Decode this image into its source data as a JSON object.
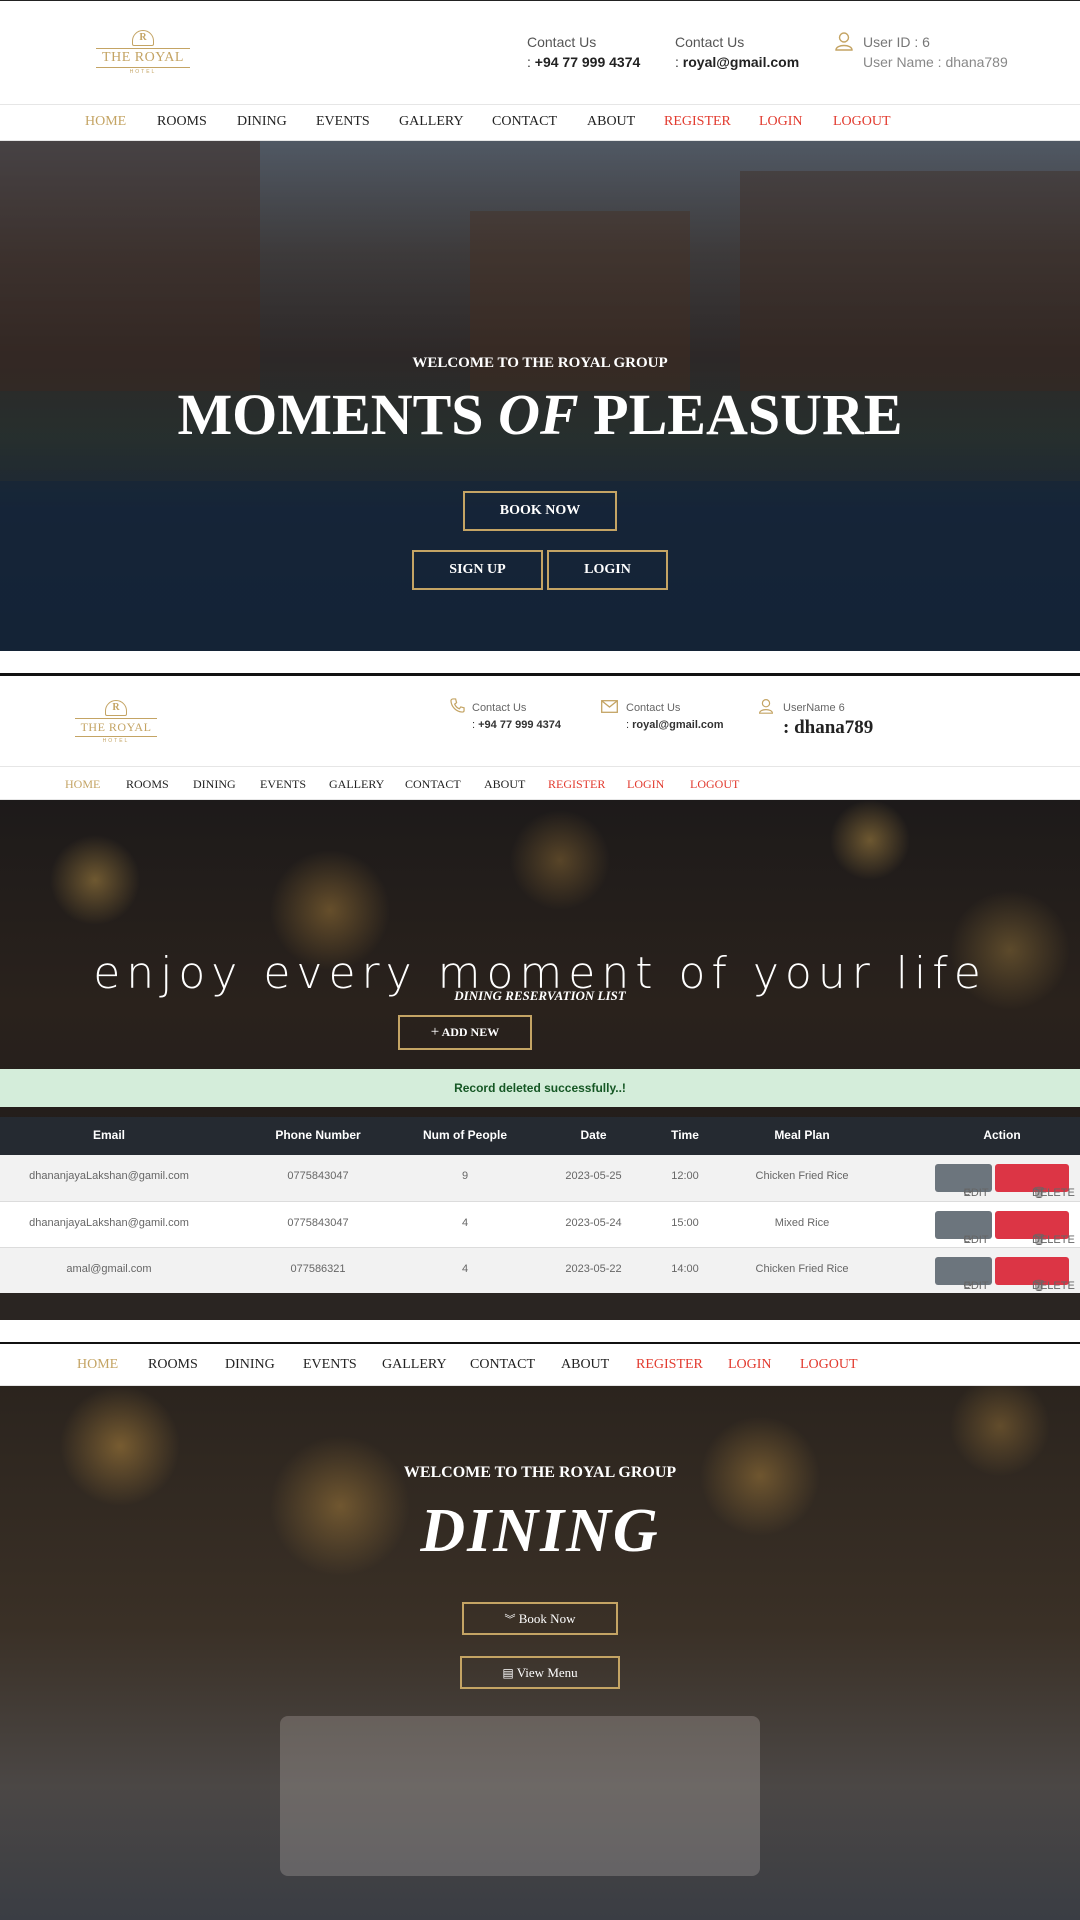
{
  "section1": {
    "logo": {
      "crest": "R",
      "name": "THE ROYAL",
      "sub": "HOTEL"
    },
    "contact_phone": {
      "label": "Contact Us",
      "prefix": ": ",
      "value": "+94 77 999 4374"
    },
    "contact_email": {
      "label": "Contact Us",
      "prefix": ": ",
      "value": "royal@gmail.com"
    },
    "user": {
      "id_line": "User ID : 6",
      "name_line": "User Name : dhana789"
    },
    "nav": [
      "HOME",
      "ROOMS",
      "DINING",
      "EVENTS",
      "GALLERY",
      "CONTACT",
      "ABOUT",
      "REGISTER",
      "LOGIN",
      "LOGOUT"
    ],
    "hero": {
      "kicker": "WELCOME TO THE ROYAL GROUP",
      "title_a": "MOMENTS ",
      "title_b": "OF",
      "title_c": " PLEASURE",
      "book_now": "BOOK NOW",
      "sign_up": "SIGN UP",
      "login": "LOGIN"
    }
  },
  "section2": {
    "logo": {
      "crest": "R",
      "name": "THE ROYAL",
      "sub": "HOTEL"
    },
    "contact_phone": {
      "label": "Contact Us",
      "prefix": ": ",
      "value": "+94 77 999 4374"
    },
    "contact_email": {
      "label": "Contact Us",
      "prefix": ": ",
      "value": "royal@gmail.com"
    },
    "user": {
      "label": "UserName 6",
      "name": ": dhana789"
    },
    "nav": [
      "HOME",
      "ROOMS",
      "DINING",
      "EVENTS",
      "GALLERY",
      "CONTACT",
      "ABOUT",
      "REGISTER",
      "LOGIN",
      "LOGOUT"
    ],
    "hero_tagline": "enjoy every moment of your life",
    "list_title": "DINING RESERVATION LIST",
    "add_new": "ADD NEW",
    "alert": "Record deleted successfully..!",
    "table": {
      "headers": [
        "Email",
        "Phone Number",
        "Num of People",
        "Date",
        "Time",
        "Meal Plan",
        "Action"
      ],
      "rows": [
        [
          "dhananjayaLakshan@gamil.com",
          "0775843047",
          "9",
          "2023-05-25",
          "12:00",
          "Chicken Fried Rice"
        ],
        [
          "dhananjayaLakshan@gamil.com",
          "0775843047",
          "4",
          "2023-05-24",
          "15:00",
          "Mixed Rice"
        ],
        [
          "amal@gmail.com",
          "077586321",
          "4",
          "2023-05-22",
          "14:00",
          "Chicken Fried Rice"
        ]
      ],
      "edit_label": "EDIT",
      "delete_label": "DELETE"
    }
  },
  "section3": {
    "nav": [
      "HOME",
      "ROOMS",
      "DINING",
      "EVENTS",
      "GALLERY",
      "CONTACT",
      "ABOUT",
      "REGISTER",
      "LOGIN",
      "LOGOUT"
    ],
    "kicker": "WELCOME TO THE ROYAL GROUP",
    "title": "DINING",
    "book_now": "Book Now",
    "view_menu": "View Menu"
  },
  "colors": {
    "gold": "#c4a464",
    "nav_red": "#e23a2e",
    "table_head": "#252a31",
    "edit": "#6c757d",
    "delete": "#dc3545",
    "alert_bg": "#d4edda",
    "alert_text": "#155724"
  },
  "icons": [
    "user-icon",
    "phone-icon",
    "mail-icon",
    "plus-icon",
    "refresh-icon",
    "trash-icon",
    "chevron-double-down-icon",
    "menu-book-icon"
  ]
}
